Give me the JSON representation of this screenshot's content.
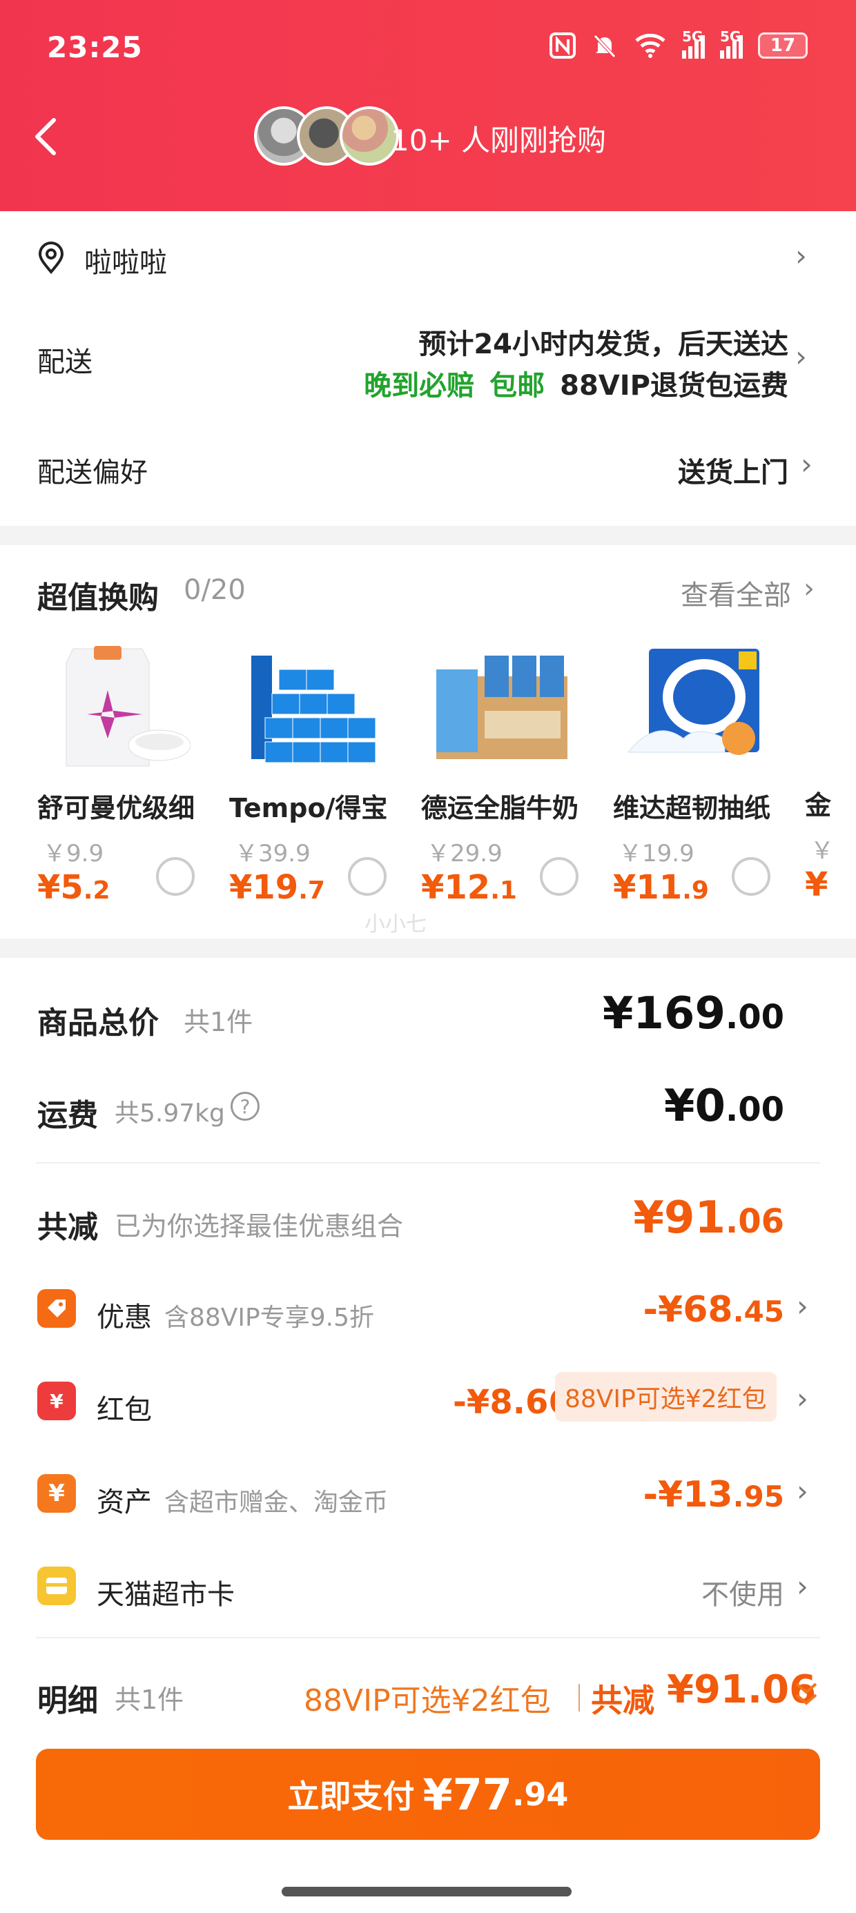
{
  "status": {
    "time": "23:25",
    "battery": "17",
    "signal_labels": [
      "5G",
      "5G"
    ],
    "icons": [
      "nfc-icon",
      "mute-icon",
      "wifi-icon",
      "signal-icon",
      "signal-icon",
      "battery-icon"
    ]
  },
  "header": {
    "title": "10+ 人刚刚抢购",
    "back_icon": "chevron-left-icon"
  },
  "address": {
    "text": "啦啦啦"
  },
  "delivery": {
    "label": "配送",
    "line1": "预计24小时内发货，后天送达",
    "tag_late": "晚到必赔",
    "tag_free": "包邮",
    "tag_vip": "88VIP退货包运费"
  },
  "delivery_pref": {
    "label": "配送偏好",
    "value": "送货上门"
  },
  "swap": {
    "title": "超值换购",
    "count": "0/20",
    "see_all": "查看全部",
    "products": [
      {
        "name": "舒可曼优级细",
        "old": "￥9.9",
        "price_int": "¥5",
        "price_dec": ".2"
      },
      {
        "name": "Tempo/得宝",
        "old": "￥39.9",
        "price_int": "¥19",
        "price_dec": ".7"
      },
      {
        "name": "德运全脂牛奶",
        "old": "￥29.9",
        "price_int": "¥12",
        "price_dec": ".1"
      },
      {
        "name": "维达超韧抽纸",
        "old": "￥19.9",
        "price_int": "¥11",
        "price_dec": ".9"
      }
    ],
    "watermark": "小小七",
    "partial_name": "金",
    "partial_old": "￥",
    "partial_price": "¥"
  },
  "summary": {
    "goods_label": "商品总价",
    "goods_count": "共1件",
    "goods_int": "¥169",
    "goods_dec": ".00",
    "ship_label": "运费",
    "ship_weight": "共5.97kg",
    "ship_int": "¥0",
    "ship_dec": ".00",
    "reduce_label": "共减",
    "reduce_desc": "已为你选择最佳优惠组合",
    "reduce_int": "¥91",
    "reduce_dec": ".06",
    "discount_label": "优惠",
    "discount_desc": "含88VIP专享9.5折",
    "discount_int": "-¥68",
    "discount_dec": ".45",
    "redpack_label": "红包",
    "redpack_value": "-¥8.66",
    "redpack_pill": "88VIP可选¥2红包",
    "asset_label": "资产",
    "asset_desc": "含超市赠金、淘金币",
    "asset_int": "-¥13",
    "asset_dec": ".95",
    "card_label": "天猫超市卡",
    "card_value": "不使用",
    "detail_label": "明细",
    "detail_count": "共1件",
    "detail_vip": "88VIP可选¥2红包",
    "detail_reduce_label": "共减",
    "detail_reduce_value": "¥91.06"
  },
  "pay": {
    "label": "立即支付",
    "int": "¥77",
    "dec": ".94"
  },
  "colors": {
    "header": "#f2354f",
    "accent": "#f25a0c",
    "green": "#22a32e"
  }
}
